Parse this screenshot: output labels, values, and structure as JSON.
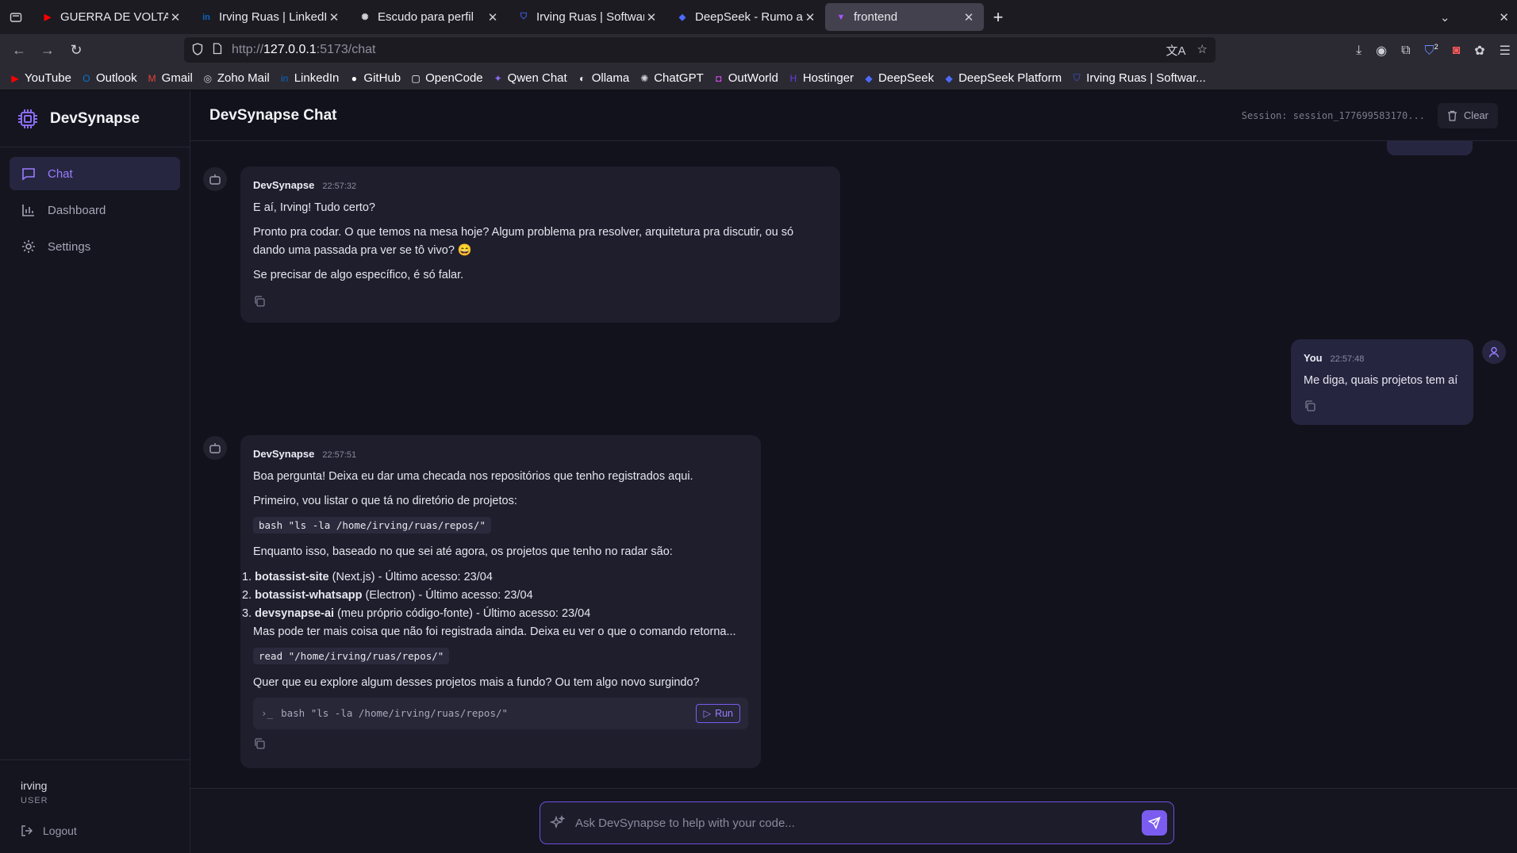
{
  "browser": {
    "tabs": [
      {
        "title": "GUERRA DE VOLTA AO I",
        "favicon": "youtube-icon",
        "color": "#ff0000"
      },
      {
        "title": "Irving Ruas | LinkedIn",
        "favicon": "linkedin-icon",
        "color": "#0a66c2"
      },
      {
        "title": "Escudo para perfil",
        "favicon": "openai-icon",
        "color": "#cfcfd8"
      },
      {
        "title": "Irving Ruas | Software, A",
        "favicon": "shield-icon",
        "color": "#3b5bdb"
      },
      {
        "title": "DeepSeek - Rumo ao De",
        "favicon": "deepseek-icon",
        "color": "#4d6bfe"
      },
      {
        "title": "frontend",
        "favicon": "vite-icon",
        "color": "#a855f7"
      }
    ],
    "url_prefix": "http://",
    "url_host": "127.0.0.1",
    "url_rest": ":5173/chat",
    "bookmarks": [
      {
        "label": "YouTube",
        "icon": "youtube-icon",
        "color": "#ff0000"
      },
      {
        "label": "Outlook",
        "icon": "outlook-icon",
        "color": "#0078d4"
      },
      {
        "label": "Gmail",
        "icon": "gmail-icon",
        "color": "#ea4335"
      },
      {
        "label": "Zoho Mail",
        "icon": "zoho-icon",
        "color": "#cfcfd8"
      },
      {
        "label": "LinkedIn",
        "icon": "linkedin-icon",
        "color": "#0a66c2"
      },
      {
        "label": "GitHub",
        "icon": "github-icon",
        "color": "#ffffff"
      },
      {
        "label": "OpenCode",
        "icon": "opencode-icon",
        "color": "#ffffff"
      },
      {
        "label": "Qwen Chat",
        "icon": "qwen-icon",
        "color": "#8b6cf6"
      },
      {
        "label": "Ollama",
        "icon": "ollama-icon",
        "color": "#ffffff"
      },
      {
        "label": "ChatGPT",
        "icon": "openai-icon",
        "color": "#cfcfd8"
      },
      {
        "label": "OutWorld",
        "icon": "outworld-icon",
        "color": "#d946ef"
      },
      {
        "label": "Hostinger",
        "icon": "hostinger-icon",
        "color": "#673de6"
      },
      {
        "label": "DeepSeek",
        "icon": "deepseek-icon",
        "color": "#4d6bfe"
      },
      {
        "label": "DeepSeek Platform",
        "icon": "deepseek-icon",
        "color": "#4d6bfe"
      },
      {
        "label": "Irving Ruas | Softwar...",
        "icon": "shield-icon",
        "color": "#3b5bdb"
      }
    ],
    "extension_badge": "2"
  },
  "app": {
    "brand": "DevSynapse",
    "nav": [
      {
        "label": "Chat",
        "icon": "chat-icon",
        "active": true
      },
      {
        "label": "Dashboard",
        "icon": "bar-chart-icon",
        "active": false
      },
      {
        "label": "Settings",
        "icon": "gear-icon",
        "active": false
      }
    ],
    "user": {
      "name": "irving",
      "role": "USER",
      "logout": "Logout"
    },
    "header": {
      "title": "DevSynapse Chat",
      "session": "Session: session_177699583170...",
      "clear": "Clear"
    },
    "accent": "#7b5cf0"
  },
  "messages": [
    {
      "sender": "DevSynapse",
      "time": "22:57:32",
      "paragraphs": [
        "E aí, Irving! Tudo certo?",
        "Pronto pra codar. O que temos na mesa hoje? Algum problema pra resolver, arquitetura pra discutir, ou só dando uma passada pra ver se tô vivo? 😄",
        "Se precisar de algo específico, é só falar."
      ]
    },
    {
      "sender": "You",
      "time": "22:57:48",
      "text": "Me diga, quais projetos tem aí"
    },
    {
      "sender": "DevSynapse",
      "time": "22:57:51",
      "p1": "Boa pergunta! Deixa eu dar uma checada nos repositórios que tenho registrados aqui.",
      "p2": "Primeiro, vou listar o que tá no diretório de projetos:",
      "code1": "bash \"ls -la /home/irving/ruas/repos/\"",
      "p3": "Enquanto isso, baseado no que sei até agora, os projetos que tenho no radar são:",
      "list": [
        {
          "num": "1.",
          "name": "botassist-site",
          "desc": " (Next.js) - Último acesso: 23/04"
        },
        {
          "num": "2.",
          "name": "botassist-whatsapp",
          "desc": " (Electron) - Último acesso: 23/04"
        },
        {
          "num": "3.",
          "name": "devsynapse-ai",
          "desc": " (meu próprio código-fonte) - Último acesso: 23/04"
        }
      ],
      "p4": "Mas pode ter mais coisa que não foi registrada ainda. Deixa eu ver o que o comando retorna...",
      "code2": "read \"/home/irving/ruas/repos/\"",
      "p5": "Quer que eu explore algum desses projetos mais a fundo? Ou tem algo novo surgindo?",
      "run_command": "bash \"ls -la /home/irving/ruas/repos/\"",
      "run_label": "Run"
    }
  ],
  "composer": {
    "placeholder": "Ask DevSynapse to help with your code..."
  }
}
